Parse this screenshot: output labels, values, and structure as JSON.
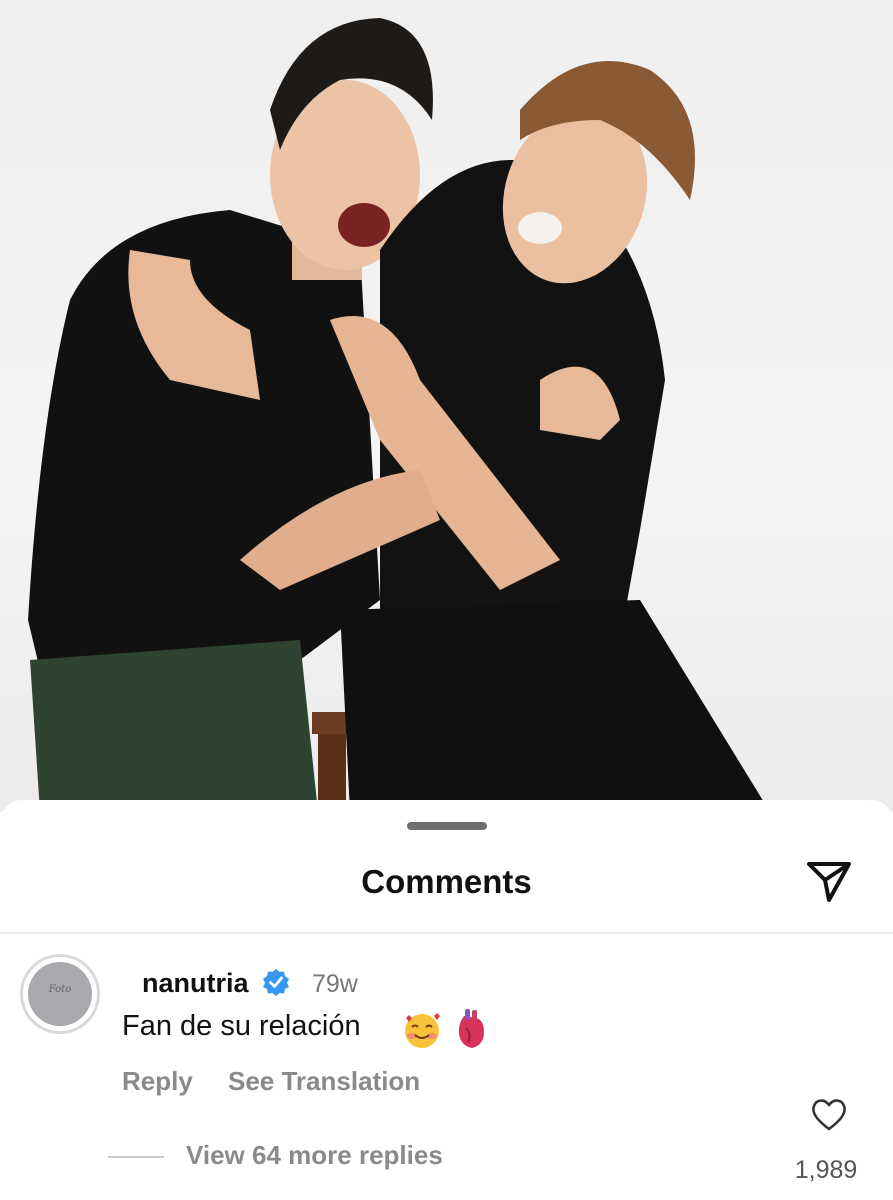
{
  "sheet": {
    "title": "Comments",
    "share_icon": "paper-plane-icon"
  },
  "comment": {
    "avatar_label": "Foto",
    "username": "nanutria",
    "verified_icon": "verified-badge-icon",
    "time": "79w",
    "text": "Fan de su relación",
    "emojis": [
      "smiling-face-with-hearts",
      "anatomical-heart"
    ],
    "like_icon": "heart-outline-icon",
    "like_count": "1,989",
    "reply_label": "Reply",
    "translate_label": "See Translation",
    "view_replies_label": "View 64 more replies"
  },
  "colors": {
    "accent_blue": "#3897f0",
    "muted_text": "#8a8a8a"
  }
}
